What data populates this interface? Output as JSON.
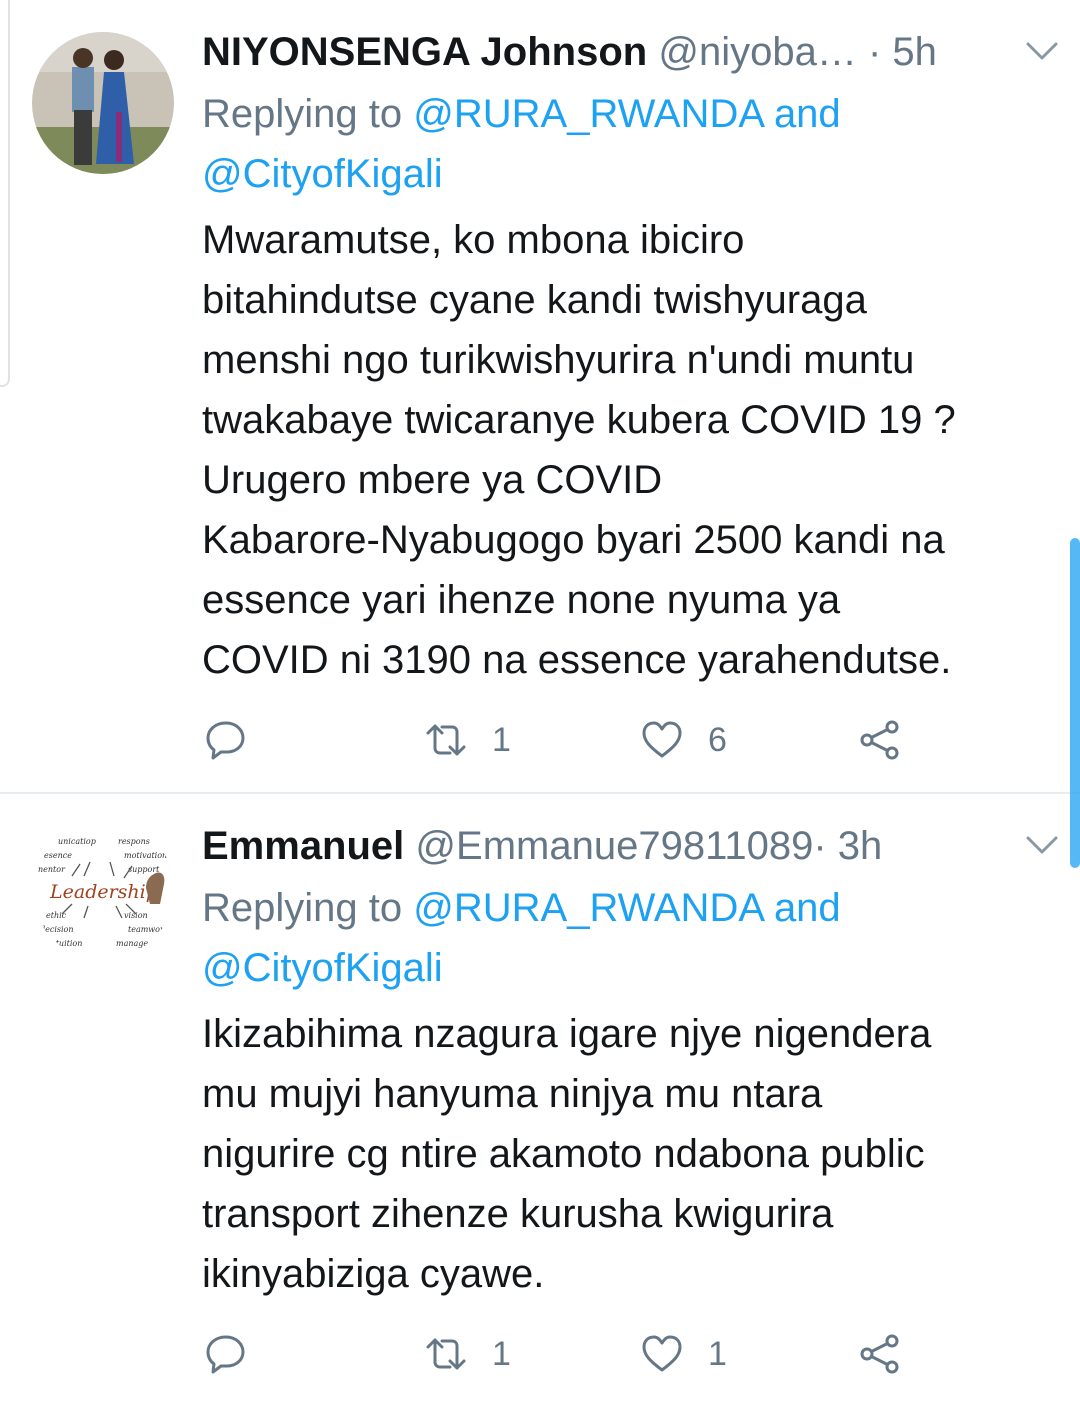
{
  "tweets": [
    {
      "name": "NIYONSENGA Johnson",
      "handle": "@niyoba…",
      "separator": "·",
      "time": "5h",
      "replying_prefix": "Replying to",
      "replying_mention1": "@RURA_RWANDA",
      "replying_and": "and",
      "replying_mention2": "@CityofKigali",
      "text": "Mwaramutse, ko mbona ibiciro\nbitahindutse cyane kandi twishyuraga\nmenshi ngo turikwishyurira n'undi muntu\ntwakabaye twicaranye kubera COVID 19 ?\nUrugero mbere ya COVID\nKabarore-Nyabugogo byari 2500 kandi na\nessence yari ihenze none nyuma ya\nCOVID ni 3190  na essence yarahendutse.",
      "retweets": "1",
      "likes": "6",
      "icons": [
        "reply-icon",
        "retweet-icon",
        "like-icon",
        "share-icon"
      ]
    },
    {
      "name": "Emmanuel",
      "handle": "@Emmanue79811089",
      "separator": "·",
      "time": "3h",
      "replying_prefix": "Replying to",
      "replying_mention1": "@RURA_RWANDA",
      "replying_and": "and",
      "replying_mention2": "@CityofKigali",
      "text": "Ikizabihima nzagura igare njye nigendera\nmu mujyi hanyuma ninjya mu ntara\nnigurire cg ntire akamoto ndabona public\ntransport zihenze kurusha kwigurira\nikinyabiziga cyawe.",
      "retweets": "1",
      "likes": "1",
      "avatar_image_text": [
        "unicatiop",
        "respons",
        "esence",
        "motivation",
        "nentor",
        "support",
        "Leadership",
        "ethic",
        "vision",
        "decision",
        "teamwork",
        "intuition",
        "manage"
      ],
      "icons": [
        "reply-icon",
        "retweet-icon",
        "like-icon",
        "share-icon"
      ]
    }
  ],
  "colors": {
    "accent": "#1da1f2",
    "secondary_text": "#657786",
    "primary_text": "#14171a",
    "divider": "#e6ecf0"
  }
}
